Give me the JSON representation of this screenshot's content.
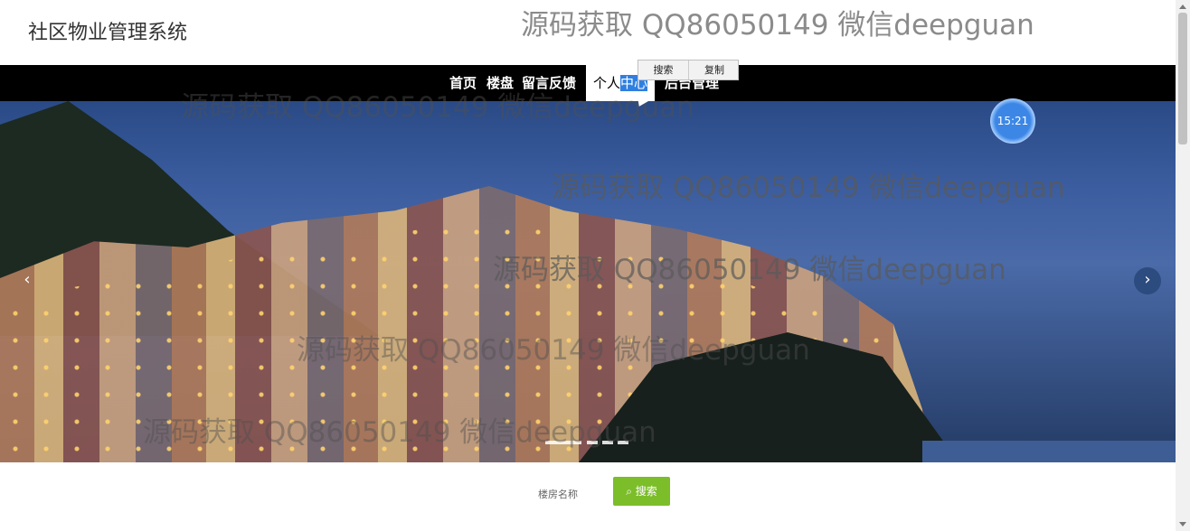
{
  "header": {
    "site_title": "社区物业管理系统"
  },
  "nav": {
    "items": [
      {
        "label": "首页"
      },
      {
        "label": "楼盘"
      },
      {
        "label": "留言反馈"
      },
      {
        "label_prefix": "个人",
        "label_selected": "中心"
      },
      {
        "label": "后台管理"
      }
    ]
  },
  "context_menu": {
    "search_label": "搜索",
    "copy_label": "复制"
  },
  "banner": {
    "prev_icon": "chevron-left-icon",
    "next_icon": "chevron-right-icon",
    "slide_count": 5
  },
  "clock": {
    "time": "15:21"
  },
  "watermarks": [
    "源码获取 QQ86050149 微信deepguan",
    "源码获取 QQ86050149 微信deepguan",
    "源码获取 QQ86050149 微信deepguan",
    "源码获取 QQ86050149 微信deepguan",
    "源码获取 QQ86050149 微信deepguan",
    "源码获取 QQ86050149 微信deepguan"
  ],
  "search": {
    "label": "楼房名称",
    "button_label": "搜索",
    "button_icon": "search-icon"
  },
  "colors": {
    "nav_bg": "#000000",
    "accent": "#7cbd2a",
    "selection": "#2f7fe0"
  }
}
